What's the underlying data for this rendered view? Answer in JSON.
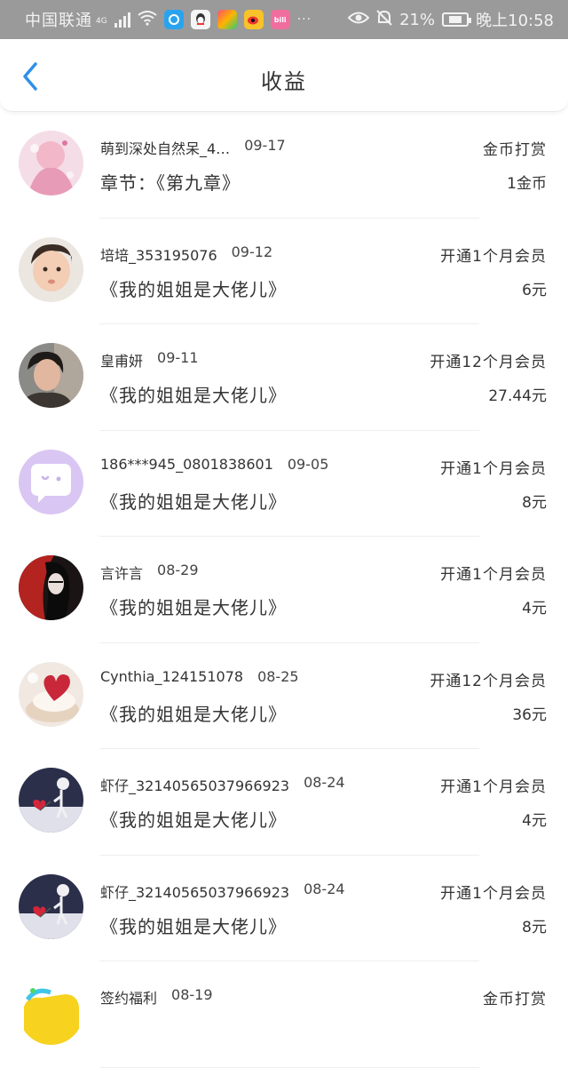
{
  "status_bar": {
    "carrier": "中国联通",
    "network": "4G",
    "battery": "21%",
    "time": "晚上10:58",
    "more": "···"
  },
  "header": {
    "title": "收益"
  },
  "rows": [
    {
      "name": "萌到深处自然呆_4…",
      "date": "09-17",
      "type": "金币打赏",
      "book": "章节：《第九章》",
      "amount": "1金币"
    },
    {
      "name": "培培_353195076",
      "date": "09-12",
      "type": "开通1个月会员",
      "book": "《我的姐姐是大佬儿》",
      "amount": "6元"
    },
    {
      "name": "皇甫妍",
      "date": "09-11",
      "type": "开通12个月会员",
      "book": "《我的姐姐是大佬儿》",
      "amount": "27.44元"
    },
    {
      "name": "186***945_0801838601",
      "date": "09-05",
      "type": "开通1个月会员",
      "book": "《我的姐姐是大佬儿》",
      "amount": "8元"
    },
    {
      "name": "言许言",
      "date": "08-29",
      "type": "开通1个月会员",
      "book": "《我的姐姐是大佬儿》",
      "amount": "4元"
    },
    {
      "name": "Cynthia_124151078",
      "date": "08-25",
      "type": "开通12个月会员",
      "book": "《我的姐姐是大佬儿》",
      "amount": "36元"
    },
    {
      "name": "虾仔_32140565037966923",
      "date": "08-24",
      "type": "开通1个月会员",
      "book": "《我的姐姐是大佬儿》",
      "amount": "4元"
    },
    {
      "name": "虾仔_32140565037966923",
      "date": "08-24",
      "type": "开通1个月会员",
      "book": "《我的姐姐是大佬儿》",
      "amount": "8元"
    },
    {
      "name": "签约福利",
      "date": "08-19",
      "type": "金币打赏",
      "book": "",
      "amount": ""
    }
  ],
  "colors": {
    "status_bar_bg": "#9a9a9a",
    "back_arrow": "#2f8fe8",
    "default_avatar": "#d9c6f3"
  }
}
